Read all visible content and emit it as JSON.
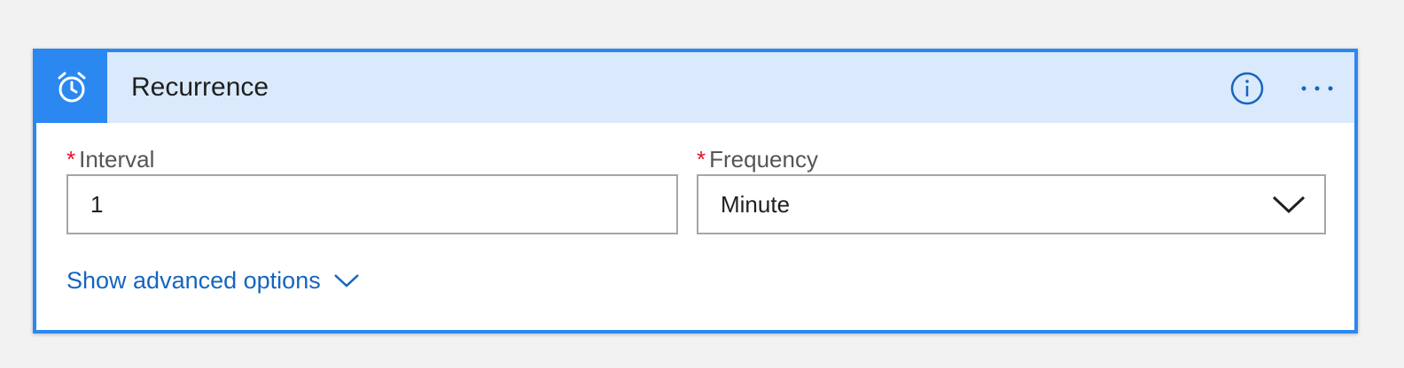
{
  "card": {
    "title": "Recurrence",
    "header_icon": "alarm-clock-icon",
    "info_icon": "info-icon",
    "more_icon": "more-options-icon"
  },
  "fields": {
    "interval": {
      "label": "Interval",
      "required_marker": "*",
      "value": "1"
    },
    "frequency": {
      "label": "Frequency",
      "required_marker": "*",
      "value": "Minute"
    }
  },
  "advanced": {
    "label": "Show advanced options"
  },
  "colors": {
    "accent": "#2b88f0",
    "header_bg": "#daeafc",
    "link": "#1565c0",
    "required": "#e81123"
  }
}
